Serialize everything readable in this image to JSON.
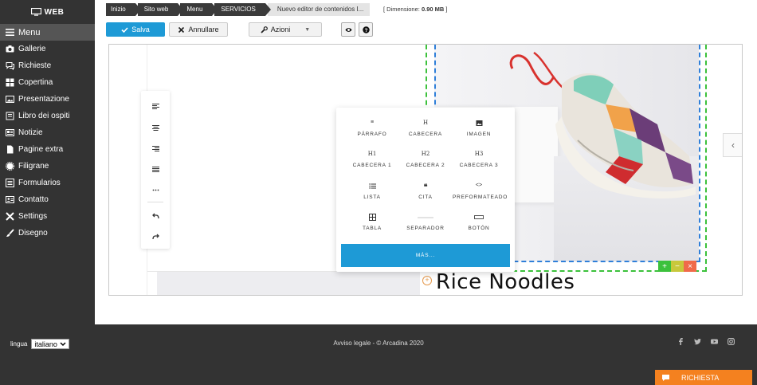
{
  "sidebar": {
    "brand": "WEB",
    "items": [
      {
        "label": "Menu",
        "icon": "menu-icon"
      },
      {
        "label": "Gallerie",
        "icon": "camera-icon"
      },
      {
        "label": "Richieste",
        "icon": "chat-icon"
      },
      {
        "label": "Copertina",
        "icon": "grid-icon"
      },
      {
        "label": "Presentazione",
        "icon": "image-icon"
      },
      {
        "label": "Libro dei ospiti",
        "icon": "book-icon"
      },
      {
        "label": "Notizie",
        "icon": "news-icon"
      },
      {
        "label": "Pagine extra",
        "icon": "page-icon"
      },
      {
        "label": "Filigrane",
        "icon": "seal-icon"
      },
      {
        "label": "Formularios",
        "icon": "list-icon"
      },
      {
        "label": "Contatto",
        "icon": "contact-icon"
      },
      {
        "label": "Settings",
        "icon": "tools-icon"
      },
      {
        "label": "Disegno",
        "icon": "brush-icon"
      }
    ]
  },
  "breadcrumb": [
    "Inizio",
    "Sito web",
    "Menu",
    "SERVICIOS",
    "Nuevo editor de contenidos I..."
  ],
  "dimension": {
    "label": "[ Dimensione:",
    "value": "0.90 MB",
    "suffix": "]"
  },
  "toolbar": {
    "save": "Salva",
    "cancel": "Annullare",
    "actions": "Azioni"
  },
  "popup": {
    "items": [
      {
        "glyph": "≡",
        "label": "PÁRRAFO"
      },
      {
        "glyph": "H",
        "label": "CABECERA"
      },
      {
        "glyph": "",
        "label": "IMAGEN"
      },
      {
        "glyph": "H1",
        "label": "CABECERA 1"
      },
      {
        "glyph": "H2",
        "label": "CABECERA 2"
      },
      {
        "glyph": "H3",
        "label": "CABECERA 3"
      },
      {
        "glyph": "",
        "label": "LISTA"
      },
      {
        "glyph": "❝",
        "label": "CITA"
      },
      {
        "glyph": "<>",
        "label": "PREFORMATEADO"
      },
      {
        "glyph": "",
        "label": "TABLA"
      },
      {
        "glyph": "",
        "label": "SEPARADOR"
      },
      {
        "glyph": "",
        "label": "BOTÓN"
      }
    ],
    "more": "MÁS..."
  },
  "content": {
    "title": "Rice Noodles"
  },
  "footer": {
    "lang_label": "lingua",
    "lang_value": "italiano",
    "legal": "Avviso legale -  © Arcadina 2020",
    "social": [
      "facebook-icon",
      "twitter-icon",
      "youtube-icon",
      "instagram-icon"
    ],
    "cta": "RICHIESTA"
  },
  "colors": {
    "sidebar": "#333333",
    "accent": "#1e9ad6",
    "cta": "#f4811f",
    "green": "#3cc13c",
    "blue": "#2f7fd9"
  }
}
